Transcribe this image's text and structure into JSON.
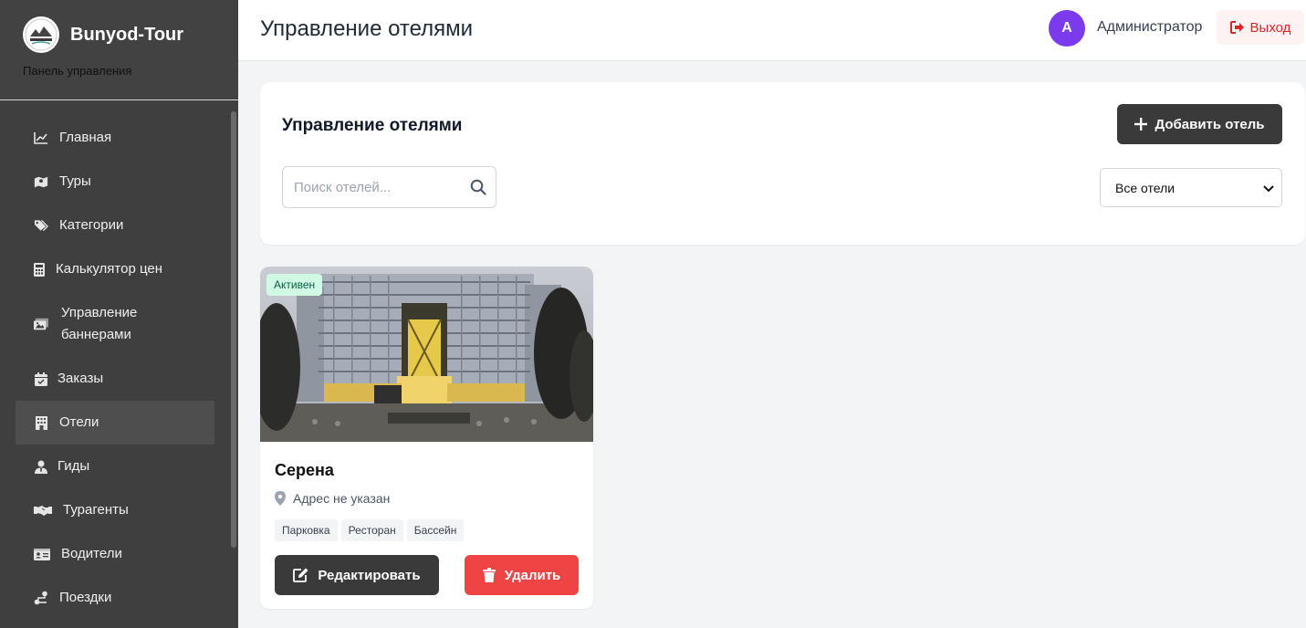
{
  "brand": {
    "name": "Bunyod-Tour",
    "subtitle": "Панель управления",
    "logo_text": "Bunyod-Tour"
  },
  "sidebar": {
    "items": [
      {
        "label": "Главная",
        "icon": "chart-line-icon",
        "active": false
      },
      {
        "label": "Туры",
        "icon": "map-icon",
        "active": false
      },
      {
        "label": "Категории",
        "icon": "tags-icon",
        "active": false
      },
      {
        "label": "Калькулятор цен",
        "icon": "calculator-icon",
        "active": false
      },
      {
        "label": "Управление баннерами",
        "icon": "images-icon",
        "active": false
      },
      {
        "label": "Заказы",
        "icon": "calendar-check-icon",
        "active": false
      },
      {
        "label": "Отели",
        "icon": "hotel-icon",
        "active": true
      },
      {
        "label": "Гиды",
        "icon": "user-tie-icon",
        "active": false
      },
      {
        "label": "Турагенты",
        "icon": "handshake-icon",
        "active": false
      },
      {
        "label": "Водители",
        "icon": "id-card-icon",
        "active": false
      },
      {
        "label": "Поездки",
        "icon": "route-icon",
        "active": false
      }
    ]
  },
  "header": {
    "title": "Управление отелями",
    "user_initial": "A",
    "user_name": "Администратор",
    "logout_label": "Выход"
  },
  "panel": {
    "title": "Управление отелями",
    "add_button": "Добавить отель",
    "search_placeholder": "Поиск отелей...",
    "filter_selected": "Все отели"
  },
  "hotels": [
    {
      "name": "Серена",
      "status": "Активен",
      "address": "Адрес не указан",
      "amenities": [
        "Парковка",
        "Ресторан",
        "Бассейн"
      ],
      "edit_label": "Редактировать",
      "delete_label": "Удалить"
    }
  ],
  "colors": {
    "sidebar_bg": "#3f3f3f",
    "sidebar_active": "#4e4e4e",
    "primary_dark": "#3a3a3a",
    "danger": "#ef4444",
    "avatar": "#7c3aed",
    "badge_bg": "#d1fae5",
    "page_bg": "#f3f4f6"
  }
}
